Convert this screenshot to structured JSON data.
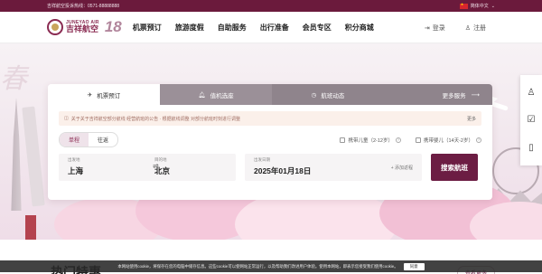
{
  "topbar": {
    "hotline": "吉祥航空投诉热线：0571-88888888",
    "language": "简体中文"
  },
  "logo": {
    "english": "JUNEYAO AIR",
    "chinese": "吉祥航空",
    "anniversary": "18"
  },
  "menu": [
    "机票预订",
    "旅游度假",
    "自助服务",
    "出行准备",
    "会员专区",
    "积分商城"
  ],
  "account": {
    "login": "登录",
    "register": "注册"
  },
  "hero": {
    "slogan": "春"
  },
  "tabs": [
    {
      "label": "机票预订",
      "icon": "plane-ticket-icon",
      "active": true
    },
    {
      "label": "值机选座",
      "icon": "bell-icon",
      "active": false
    },
    {
      "label": "航班动态",
      "icon": "clock-icon",
      "active": false
    }
  ],
  "more_services": "更多服务",
  "notice": {
    "text": "关于关于吉祥航空部分航线 经营航班的公告 · 根据航线调整 对部分航班时刻进行调整",
    "more": "更多"
  },
  "trip_type": {
    "one_way": "单程",
    "round_trip": "往返"
  },
  "passenger_options": {
    "child": "携带儿童（2-12岁）",
    "infant": "携带婴儿（14天-2岁）"
  },
  "search": {
    "from_label": "出发地",
    "from_value": "上海",
    "to_label": "目的地",
    "to_value": "北京",
    "date_label": "出发日期",
    "date_value": "2025年01月18日",
    "add_return": "+ 添加返程",
    "button": "搜索航班"
  },
  "section": {
    "title": "热门特惠",
    "more": "查看更多"
  },
  "cookie": {
    "text": "本网站使用cookie，将保存在您的电脑中储存信息。这些cookie可以使网站正常运行，以及帮助我们改进用户体验。使用本网站，即表示您接受我们使用cookie。",
    "agree": "同意"
  },
  "colors": {
    "brand": "#6c1d43",
    "topbar": "#6b1a3c"
  }
}
